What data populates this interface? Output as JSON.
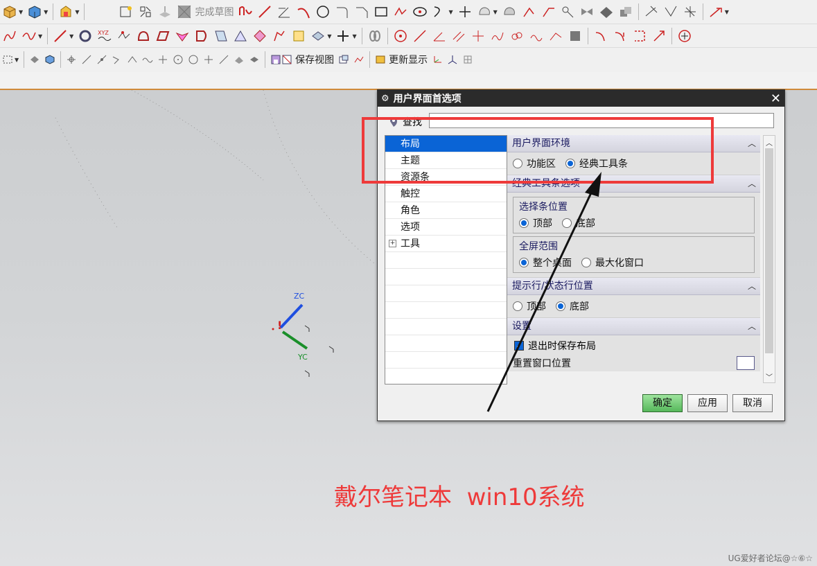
{
  "toolbar": {
    "finish_sketch_label": "完成草图",
    "save_view_label": "保存视图",
    "update_display_label": "更新显示"
  },
  "dialog": {
    "title": "用户界面首选项",
    "find_label": "查找",
    "find_value": "",
    "tree_items": [
      {
        "label": "布局",
        "selected": true
      },
      {
        "label": "主题",
        "selected": false
      },
      {
        "label": "资源条",
        "selected": false
      },
      {
        "label": "触控",
        "selected": false
      },
      {
        "label": "角色",
        "selected": false
      },
      {
        "label": "选项",
        "selected": false
      },
      {
        "label": "工具",
        "selected": false,
        "expandable": true
      }
    ],
    "sections": {
      "env": {
        "title": "用户界面环境",
        "options": [
          {
            "label": "功能区",
            "checked": false
          },
          {
            "label": "经典工具条",
            "checked": true
          }
        ]
      },
      "classic": {
        "title": "经典工具条选项",
        "select_bar": {
          "title": "选择条位置",
          "options": [
            {
              "label": "顶部",
              "checked": true
            },
            {
              "label": "底部",
              "checked": false
            }
          ]
        },
        "fullscreen": {
          "title": "全屏范围",
          "options": [
            {
              "label": "整个桌面",
              "checked": true
            },
            {
              "label": "最大化窗口",
              "checked": false
            }
          ]
        }
      },
      "prompt": {
        "title": "提示行/状态行位置",
        "options": [
          {
            "label": "顶部",
            "checked": false
          },
          {
            "label": "底部",
            "checked": true
          }
        ]
      },
      "settings": {
        "title": "设置",
        "save_on_exit_label": "退出时保存布局",
        "save_on_exit_checked": true,
        "reset_label": "重置窗口位置"
      }
    },
    "buttons": {
      "ok": "确定",
      "apply": "应用",
      "cancel": "取消"
    }
  },
  "viewport": {
    "zc_label": "ZC",
    "yc_label": "YC"
  },
  "annotation": {
    "caption": "戴尔笔记本  win10系统",
    "highlight_color": "#ee3a3a"
  },
  "watermark": "UG爱好者论坛@☆⑥☆",
  "colors": {
    "selection": "#0a64d6",
    "ok_button": "#56b85b",
    "zc_axis": "#1f4fe0",
    "yc_axis": "#1a8f2a"
  }
}
